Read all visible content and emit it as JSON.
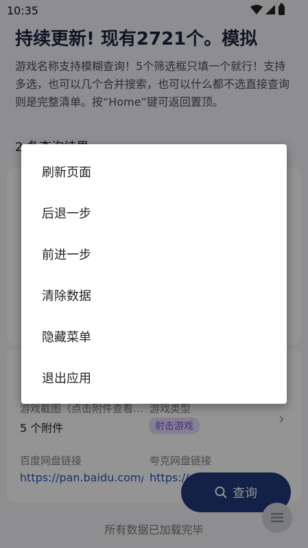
{
  "status": {
    "time": "10:35"
  },
  "header": {
    "title": "持续更新! 现有2721个。模拟",
    "description": "游戏名称支持模糊查询！5个筛选框只填一个就行！支持多选，也可以几个合并搜索，也可以什么都不选直接查询则是完整清单。按“Home”键可返回置顶。"
  },
  "results": {
    "count_text": "2 条查询结果"
  },
  "card2": {
    "screenshot_label": "游戏截图（点击附件查看...",
    "attachments": "5 个附件",
    "type_label": "游戏类型",
    "type_tag": "射击游戏",
    "baidu_label": "百度网盘链接",
    "baidu_link": "https://pan.baidu.com/",
    "quark_label": "夸克网盘链接",
    "quark_link": "https://"
  },
  "fab": {
    "label": "查询"
  },
  "footer": {
    "text": "所有数据已加载完毕"
  },
  "menu": {
    "items": [
      "刷新页面",
      "后退一步",
      "前进一步",
      "清除数据",
      "隐藏菜单",
      "退出应用"
    ]
  },
  "colors": {
    "accent": "#1f3a77",
    "tag": "#7b4fd6",
    "link": "#2a52be"
  }
}
